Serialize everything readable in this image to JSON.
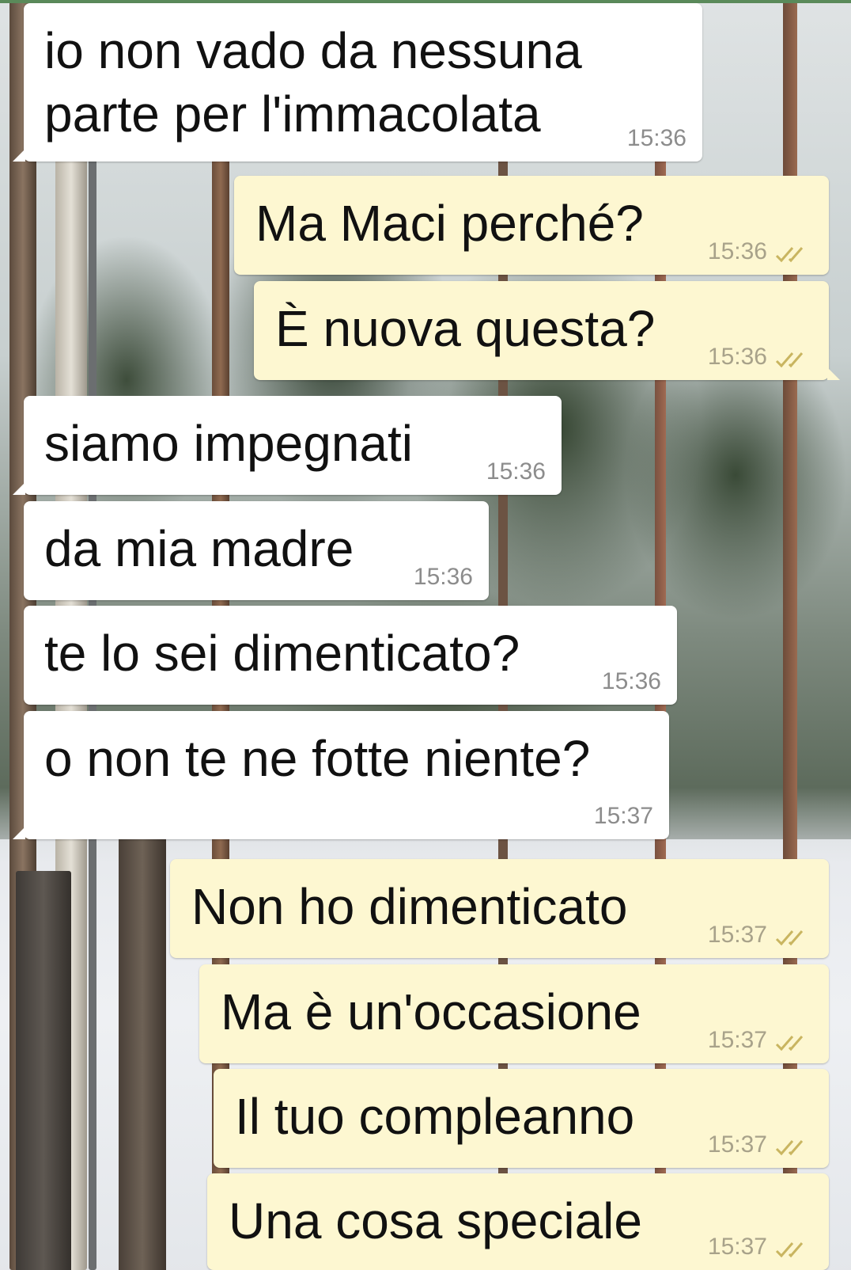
{
  "conversation": {
    "messages": [
      {
        "direction": "incoming",
        "lines": [
          "io non vado da nessuna",
          "parte per l'immacolata"
        ],
        "time": "15:36"
      },
      {
        "direction": "outgoing",
        "text": "Ma Maci perché?",
        "time": "15:36",
        "status_icon": "double-check-icon"
      },
      {
        "direction": "outgoing",
        "text": "È nuova questa?",
        "time": "15:36",
        "status_icon": "double-check-icon"
      },
      {
        "direction": "incoming",
        "text": "siamo impegnati",
        "time": "15:36"
      },
      {
        "direction": "incoming",
        "text": "da mia madre",
        "time": "15:36"
      },
      {
        "direction": "incoming",
        "text": "te lo sei dimenticato?",
        "time": "15:36"
      },
      {
        "direction": "incoming",
        "text": "o non te ne fotte niente?",
        "time": "15:37"
      },
      {
        "direction": "outgoing",
        "text": "Non ho dimenticato",
        "time": "15:37",
        "status_icon": "double-check-icon"
      },
      {
        "direction": "outgoing",
        "text": "Ma è un'occasione",
        "time": "15:37",
        "status_icon": "double-check-icon"
      },
      {
        "direction": "outgoing",
        "text": "Il tuo compleanno",
        "time": "15:37",
        "status_icon": "double-check-icon"
      },
      {
        "direction": "outgoing",
        "text": "Una cosa speciale",
        "time": "15:37",
        "status_icon": "double-check-icon"
      }
    ]
  },
  "colors": {
    "incoming_bubble": "#ffffff",
    "outgoing_bubble": "#fdf7d1",
    "timestamp_in": "#8c8c8c",
    "timestamp_out": "#a8a28a",
    "read_ticks": "#c9b560"
  }
}
